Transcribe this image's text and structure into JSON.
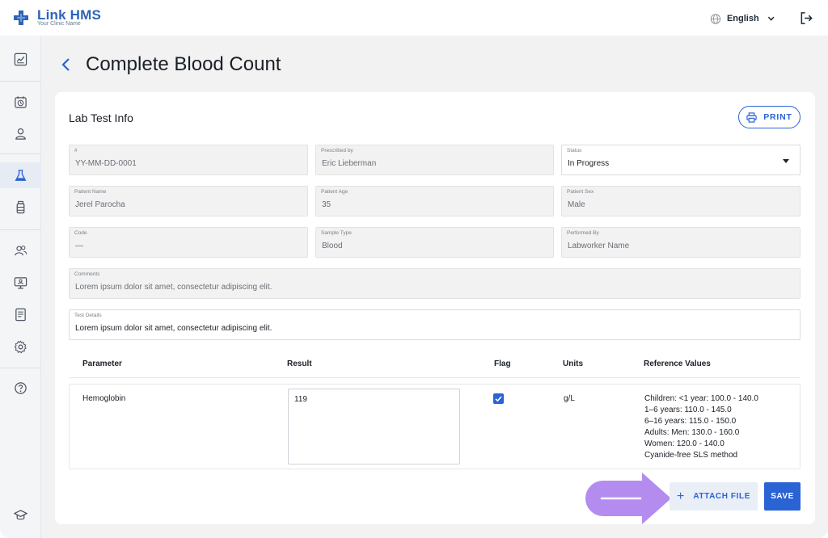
{
  "brand": {
    "name": "Link HMS",
    "tagline": "Your Clinic Name",
    "accent": "#2a63d4"
  },
  "topbar": {
    "language": "English",
    "language_icon": "globe-icon",
    "logout_icon": "logout-icon"
  },
  "sidebar": {
    "items": [
      {
        "name": "dashboard",
        "icon": "chart-icon"
      },
      {
        "name": "appointments",
        "icon": "clock-icon"
      },
      {
        "name": "patients",
        "icon": "person-icon"
      },
      {
        "name": "lab",
        "icon": "flask-icon",
        "active": true
      },
      {
        "name": "pharmacy",
        "icon": "bottle-icon"
      },
      {
        "name": "staff",
        "icon": "users-icon"
      },
      {
        "name": "monitor",
        "icon": "monitor-icon"
      },
      {
        "name": "reports",
        "icon": "document-icon"
      },
      {
        "name": "settings",
        "icon": "gear-icon"
      },
      {
        "name": "help",
        "icon": "help-icon"
      },
      {
        "name": "education",
        "icon": "graduation-cap-icon"
      }
    ]
  },
  "page": {
    "title": "Complete Blood Count"
  },
  "card": {
    "title": "Lab Test Info",
    "print_label": "PRINT"
  },
  "fields": {
    "id": {
      "label": "#",
      "value": "YY-MM-DD-0001"
    },
    "prescribed_by": {
      "label": "Prescribed by",
      "value": "Eric Lieberman"
    },
    "status": {
      "label": "Status",
      "value": "In Progress"
    },
    "patient_name": {
      "label": "Patient Name",
      "value": "Jerel Parocha"
    },
    "patient_age": {
      "label": "Patient Age",
      "value": "35"
    },
    "patient_sex": {
      "label": "Patient Sex",
      "value": "Male"
    },
    "code": {
      "label": "Code",
      "value": "—"
    },
    "sample_type": {
      "label": "Sample Type",
      "value": "Blood"
    },
    "performed_by": {
      "label": "Performed By",
      "value": "Labworker Name"
    },
    "comments": {
      "label": "Comments",
      "value": "Lorem ipsum dolor sit amet, consectetur adipiscing elit."
    },
    "test_details": {
      "label": "Test Details",
      "value": "Lorem ipsum dolor sit amet, consectetur adipiscing elit."
    }
  },
  "table": {
    "columns": [
      "Parameter",
      "Result",
      "Flag",
      "Units",
      "Reference Values"
    ],
    "rows": [
      {
        "parameter": "Hemoglobin",
        "result": "119",
        "flag": true,
        "units": "g/L",
        "reference": [
          "Children: <1 year: 100.0 - 140.0",
          "1–6 years: 110.0 - 145.0",
          "6–16 years: 115.0 - 150.0",
          "Adults: Men: 130.0 - 160.0",
          "Women: 120.0 - 140.0",
          "Cyanide-free SLS method"
        ]
      }
    ]
  },
  "actions": {
    "attach_label": "ATTACH FILE",
    "save_label": "SAVE",
    "hint_color": "#b48cf0"
  }
}
